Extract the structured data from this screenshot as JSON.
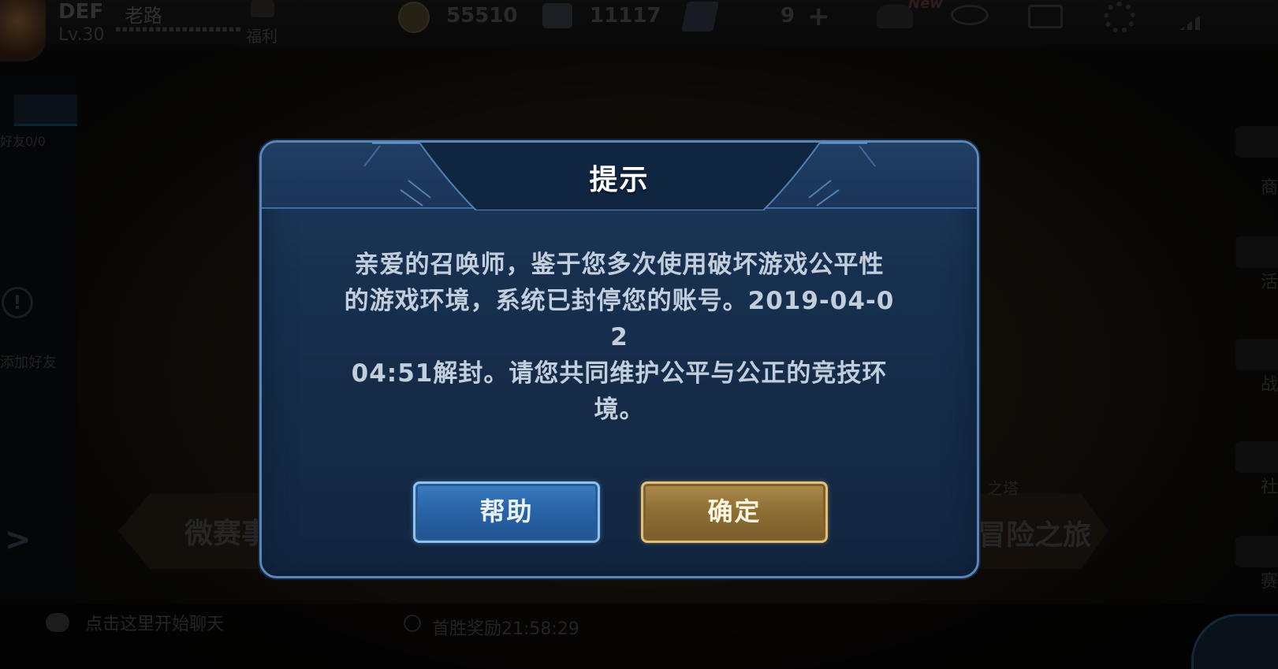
{
  "background": {
    "player": {
      "name": "DEF",
      "tag": "老路",
      "level": "Lv.30",
      "id_strip": "▪▪▪▪▪▪▪▪▪▪▪▪▪▪▪▪▪▪▪",
      "welfare_label": "福利"
    },
    "currency": {
      "gold": "55510",
      "gems": "11117",
      "coupons": "9"
    },
    "new_badge": "New",
    "left_panel": {
      "friend_count": "好友0/0",
      "add_friend": "添加好友"
    },
    "modes": {
      "left_label": "微赛事",
      "right_label": "冒险之旅",
      "right_sub": "之塔"
    },
    "right_rail": [
      "商",
      "活",
      "战",
      "社",
      "赛"
    ],
    "chat_hint": "点击这里开始聊天",
    "timer_text": "首胜奖励21:58:29"
  },
  "dialog": {
    "title": "提示",
    "message": "亲爱的召唤师，鉴于您多次使用破坏游戏公平性\n的游戏环境，系统已封停您的账号。2019-04-0\n2\n04:51解封。请您共同维护公平与公正的竞技环\n境。",
    "help_label": "帮助",
    "confirm_label": "确定"
  },
  "colors": {
    "dialog_bg": "#17304f",
    "dialog_border": "#5a86b8",
    "help_button": "#2a64a6",
    "confirm_button": "#8e6f35"
  }
}
